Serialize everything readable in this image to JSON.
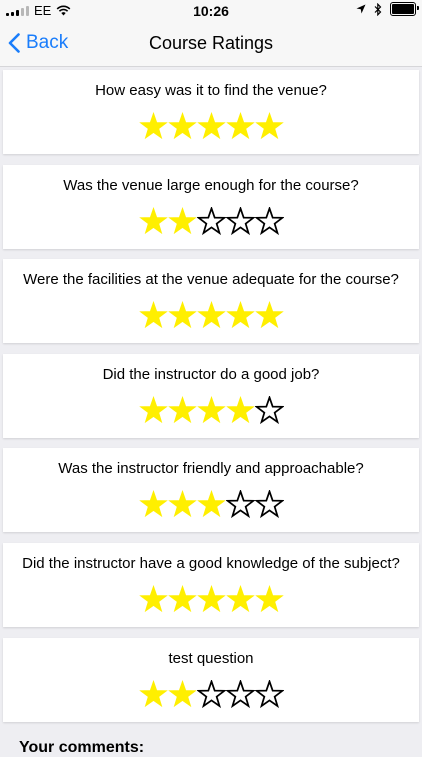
{
  "status": {
    "carrier": "EE",
    "time": "10:26"
  },
  "nav": {
    "back_label": "Back",
    "title": "Course Ratings"
  },
  "colors": {
    "star_fill": "#ffef00",
    "accent": "#1a7dfb"
  },
  "questions": [
    {
      "text": "How easy was it to find the venue?",
      "rating": 5,
      "max": 5
    },
    {
      "text": "Was the venue large enough for the course?",
      "rating": 2,
      "max": 5
    },
    {
      "text": "Were the facilities at the venue adequate for the course?",
      "rating": 5,
      "max": 5
    },
    {
      "text": "Did the instructor do a good job?",
      "rating": 4,
      "max": 5
    },
    {
      "text": "Was the instructor friendly and approachable?",
      "rating": 3,
      "max": 5
    },
    {
      "text": "Did the instructor have a good knowledge of the subject?",
      "rating": 5,
      "max": 5
    },
    {
      "text": "test question",
      "rating": 2,
      "max": 5
    }
  ],
  "comments_label": "Your comments:"
}
